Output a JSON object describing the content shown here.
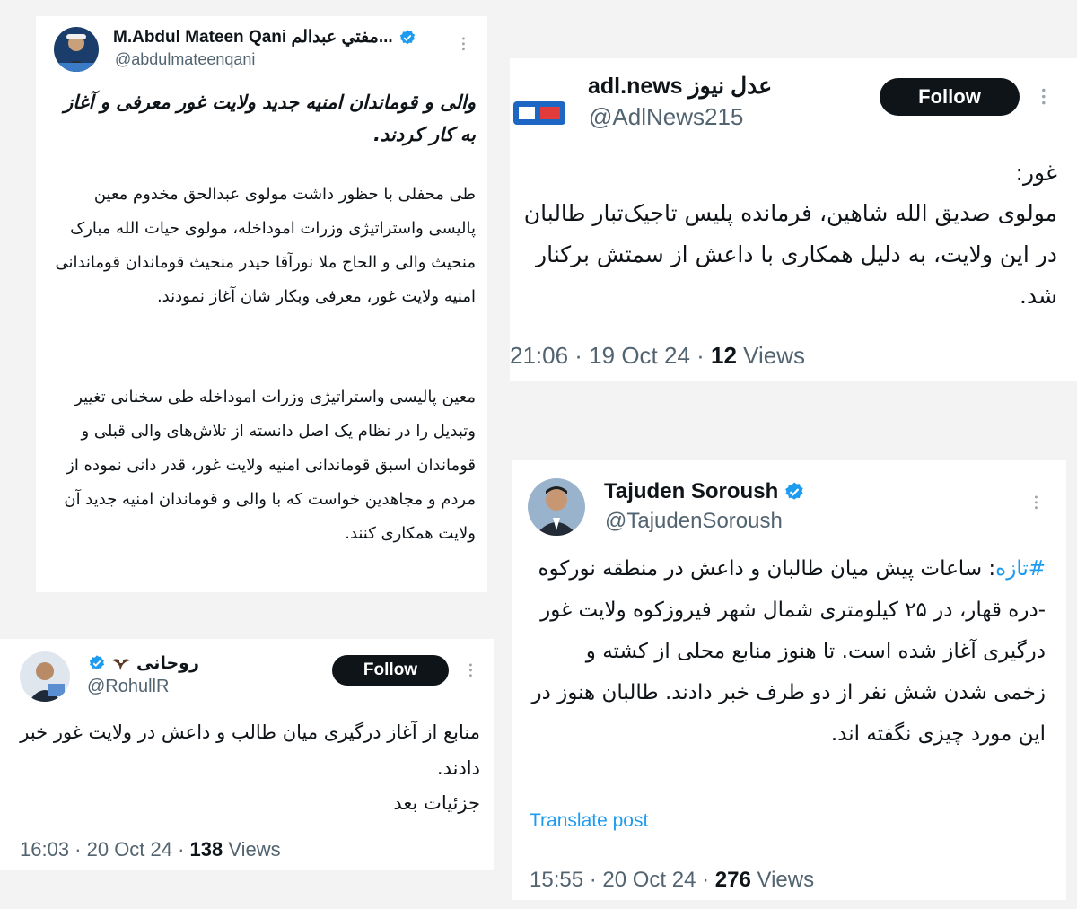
{
  "tweet1": {
    "name": "M.Abdul Mateen Qani مفتي عبدالم...",
    "handle": "@abdulmateenqani",
    "headline": "والی و قوماندان امنیه جدید ولایت غور معرفی و آغاز به کار کردند.",
    "para1": "طی محفلی با حظور داشت مولوی عبدالحق مخدوم معین پالیسی واستراتیژی وزرات اموداخله، مولوی حیات الله مبارک منحیث والی و الحاج ملا نورآقا حیدر منحیث قوماندان قوماندانی امنیه ولایت غور، معرفی وبکار شان آغاز نمودند.",
    "para2": "معین پالیسی واستراتیژی وزرات اموداخله طی سخنانی تغییر وتبدیل را در نظام یک اصل دانسته از تلاش‌های والی قبلی و قوماندان اسبق قوماندانی امنیه ولایت غور، قدر دانی نموده  از مردم و مجاهدین خواست که با والی و قوماندان امنیه جدید آن ولایت همکاری کنند."
  },
  "tweet2": {
    "name": "adl.news عدل نیوز",
    "handle": "@AdlNews215",
    "follow": "Follow",
    "text1": "غور:",
    "text2": "مولوی صدیق الله شاهین، فرمانده پلیس تاجیک‌تبار طالبان در این ولایت، به دلیل همکاری با داعش از سمتش برکنار شد.",
    "time": "21:06 · 19 Oct 24 · ",
    "views_count": "12",
    "views_label": " Views"
  },
  "tweet3": {
    "name": "روحانی",
    "handle": "@RohullR",
    "follow": "Follow",
    "text1": "منابع از آغاز درگیری میان طالب و داعش در ولایت غور خبر دادند.",
    "text2": "جزئیات بعد",
    "time": "16:03 · 20 Oct 24 · ",
    "views_count": "138",
    "views_label": " Views"
  },
  "tweet4": {
    "name": "Tajuden Soroush",
    "handle": "@TajudenSoroush",
    "hashtag": "#تازه",
    "text": ": ساعات پیش میان طالبان و داعش در منطقه نورکوه -دره قهار، در ۲۵ کیلومتری شمال شهر فیروزکوه ولایت غور درگیری آغاز شده است. تا هنوز منابع محلی از کشته و زخمی شدن شش نفر از دو طرف خبر دادند. طالبان هنوز در این مورد چیزی نگفته اند.",
    "translate": "Translate post",
    "time": "15:55 · 20 Oct 24 · ",
    "views_count": "276",
    "views_label": " Views"
  },
  "colors": {
    "verified": "#1d9bf0",
    "link": "#1d9bf0",
    "secondary": "#536471",
    "follow_bg": "#0f1419"
  }
}
